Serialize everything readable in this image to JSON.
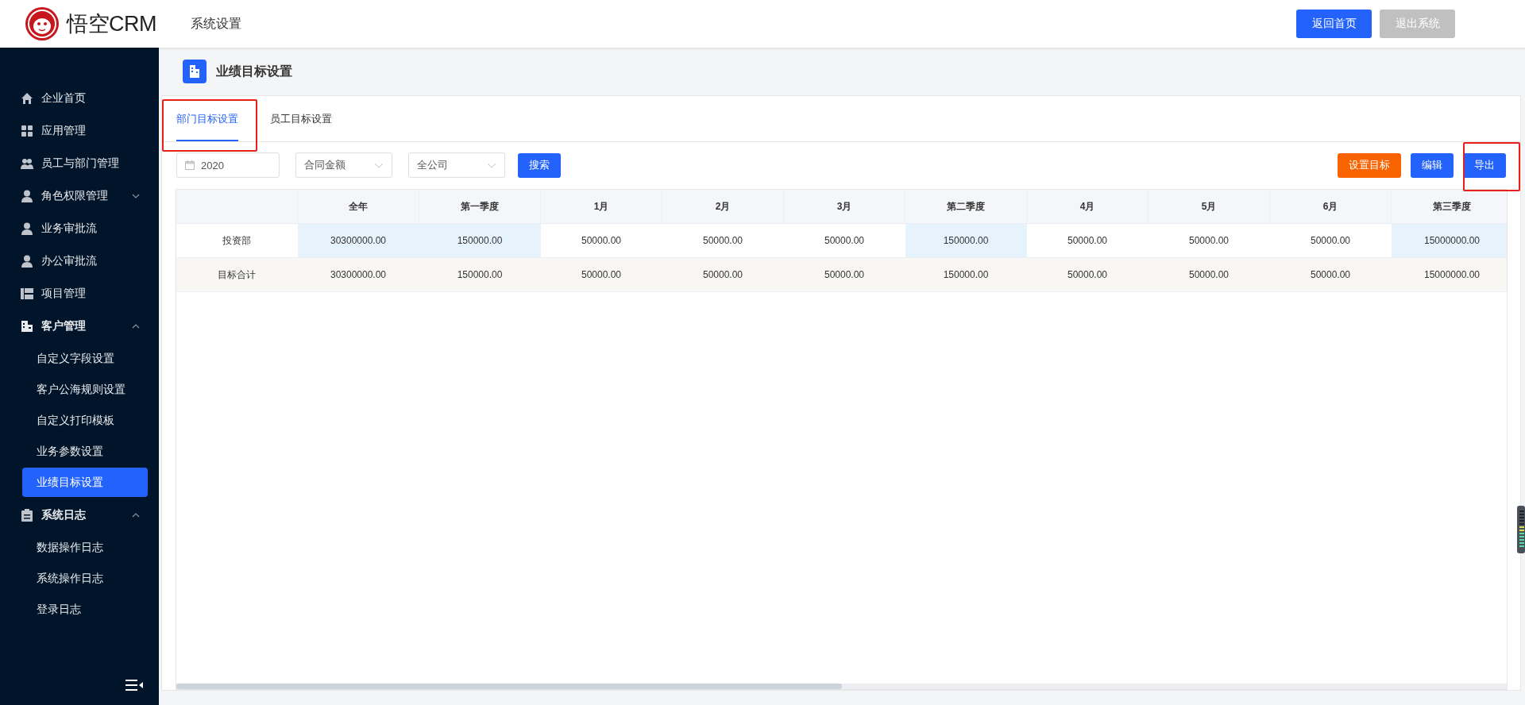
{
  "header": {
    "logo_text": "悟空CRM",
    "section": "系统设置",
    "buttons": [
      {
        "label": "返回首页",
        "disabled": false
      },
      {
        "label": "退出系统",
        "disabled": true
      }
    ]
  },
  "sidebar": {
    "items": [
      {
        "label": "企业首页",
        "selected": false
      },
      {
        "label": "应用管理",
        "selected": false
      },
      {
        "label": "员工与部门管理",
        "selected": false
      },
      {
        "label": "角色权限管理",
        "selected": false,
        "expanded": false
      },
      {
        "label": "业务审批流",
        "selected": false
      },
      {
        "label": "办公审批流",
        "selected": false
      },
      {
        "label": "项目管理",
        "selected": false
      },
      {
        "label": "客户管理",
        "selected": false,
        "expanded": true,
        "children": [
          {
            "label": "自定义字段设置",
            "selected": false
          },
          {
            "label": "客户公海规则设置",
            "selected": false
          },
          {
            "label": "自定义打印模板",
            "selected": false
          },
          {
            "label": "业务参数设置",
            "selected": false
          },
          {
            "label": "业绩目标设置",
            "selected": true
          }
        ]
      },
      {
        "label": "系统日志",
        "selected": false,
        "expanded": true,
        "children": [
          {
            "label": "数据操作日志",
            "selected": false
          },
          {
            "label": "系统操作日志",
            "selected": false
          },
          {
            "label": "登录日志",
            "selected": false
          }
        ]
      }
    ]
  },
  "page_title": "业绩目标设置",
  "tabs": [
    {
      "label": "部门目标设置",
      "selected": true
    },
    {
      "label": "员工目标设置",
      "selected": false
    }
  ],
  "filters": {
    "year": "2020",
    "metric": "合同金额",
    "scope": "全公司",
    "search_button": "搜索"
  },
  "actions": [
    {
      "label": "设置目标",
      "kind": "warning"
    },
    {
      "label": "编辑",
      "kind": "primary"
    },
    {
      "label": "导出",
      "kind": "primary"
    }
  ],
  "table": {
    "columns": [
      {
        "label": "全年",
        "summary": true
      },
      {
        "label": "第一季度",
        "summary": true
      },
      {
        "label": "1月",
        "summary": false
      },
      {
        "label": "2月",
        "summary": false
      },
      {
        "label": "3月",
        "summary": false
      },
      {
        "label": "第二季度",
        "summary": true
      },
      {
        "label": "4月",
        "summary": false
      },
      {
        "label": "5月",
        "summary": false
      },
      {
        "label": "6月",
        "summary": false
      },
      {
        "label": "第三季度",
        "summary": true
      }
    ],
    "rows": [
      {
        "name": "投资部",
        "kind": "department",
        "values": [
          "30300000.00",
          "150000.00",
          "50000.00",
          "50000.00",
          "50000.00",
          "150000.00",
          "50000.00",
          "50000.00",
          "50000.00",
          "15000000.00"
        ]
      },
      {
        "name": "目标合计",
        "kind": "total",
        "values": [
          "30300000.00",
          "150000.00",
          "50000.00",
          "50000.00",
          "50000.00",
          "150000.00",
          "50000.00",
          "50000.00",
          "50000.00",
          "15000000.00"
        ]
      }
    ]
  }
}
